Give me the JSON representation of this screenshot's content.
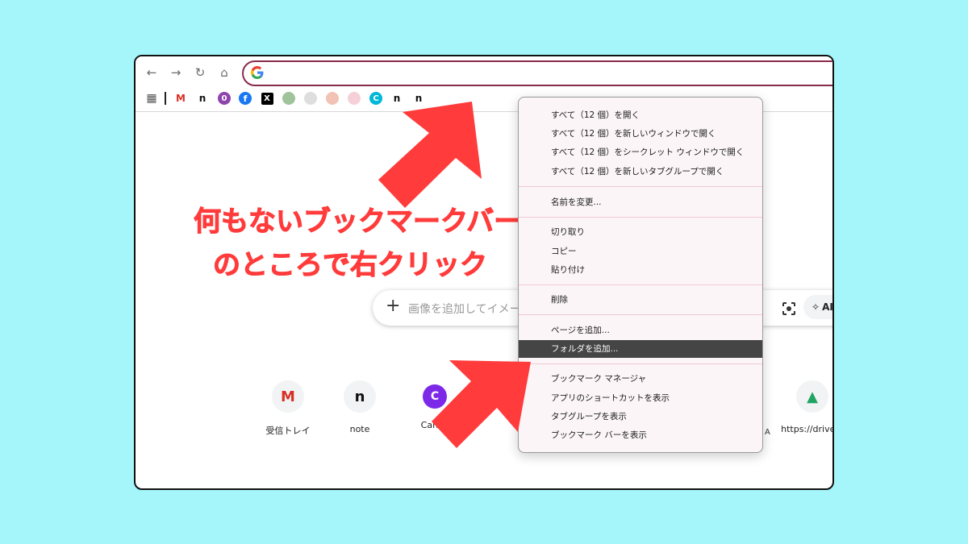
{
  "browser": {
    "nav": {
      "back_icon": "←",
      "forward_icon": "→",
      "reload_icon": "↻",
      "home_icon": "⌂"
    },
    "bookmarks": [
      {
        "name": "apps-grid",
        "glyph": "▦",
        "color": "#555555"
      },
      {
        "name": "gmail",
        "glyph": "M",
        "color": "#d93025"
      },
      {
        "name": "note",
        "glyph": "n",
        "color": "#111111"
      },
      {
        "name": "purple-app",
        "glyph": "0",
        "color": "#8e44ad"
      },
      {
        "name": "facebook",
        "glyph": "f",
        "color": "#1877f2"
      },
      {
        "name": "x",
        "glyph": "X",
        "color": "#000000"
      }
    ],
    "bookmarks_tail": [
      {
        "name": "canva",
        "glyph": "C",
        "color": "#00b8d9"
      },
      {
        "name": "note-2",
        "glyph": "n",
        "color": "#111111"
      },
      {
        "name": "note-3",
        "glyph": "n",
        "color": "#111111"
      }
    ]
  },
  "annotation": {
    "line1": "何もないブックマークバー",
    "line2": "のところで右クリック",
    "color": "#ff3b3b"
  },
  "newtab": {
    "search_plus": "+",
    "search_placeholder": "画像を追加してイメー",
    "ai_label": "AI",
    "shortcuts": [
      {
        "label": "受信トレイ",
        "glyph": "M",
        "color": "#d93025"
      },
      {
        "label": "note",
        "glyph": "n",
        "color": "#111111"
      },
      {
        "label": "Canva",
        "glyph": "C",
        "color": "#7d2ae8"
      },
      {
        "label": "https://drive.g",
        "glyph": "▲",
        "color": "#1fa463"
      }
    ],
    "hidden_fragment": "A"
  },
  "context_menu": {
    "groups": [
      [
        "すべて（12 個）を開く",
        "すべて（12 個）を新しいウィンドウで開く",
        "すべて（12 個）をシークレット ウィンドウで開く",
        "すべて（12 個）を新しいタブグループで開く"
      ],
      [
        "名前を変更..."
      ],
      [
        "切り取り",
        "コピー",
        "貼り付け"
      ],
      [
        "削除"
      ],
      [
        "ページを追加...",
        "フォルダを追加..."
      ],
      [
        "ブックマーク マネージャ",
        "アプリのショートカットを表示",
        "タブグループを表示",
        "ブックマーク バーを表示"
      ]
    ],
    "highlighted": "フォルダを追加..."
  }
}
